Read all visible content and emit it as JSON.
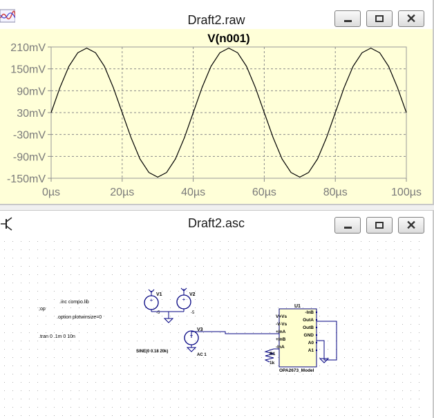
{
  "raw_window": {
    "title": "Draft2.raw",
    "icon": "waveform-icon",
    "controls": {
      "minimize": "minimize-icon",
      "maximize": "maximize-icon",
      "close": "close-icon"
    }
  },
  "asc_window": {
    "title": "Draft2.asc",
    "icon": "transistor-icon",
    "controls": {
      "minimize": "minimize-icon",
      "maximize": "maximize-icon",
      "close": "close-icon"
    }
  },
  "chart_data": {
    "type": "line",
    "title": "V(n001)",
    "xlabel": "",
    "ylabel": "",
    "x_ticks": [
      "0µs",
      "20µs",
      "40µs",
      "60µs",
      "80µs",
      "100µs"
    ],
    "y_ticks": [
      "210mV",
      "150mV",
      "90mV",
      "30mV",
      "-30mV",
      "-90mV",
      "-150mV"
    ],
    "xlim": [
      0,
      100
    ],
    "ylim": [
      -150,
      210
    ],
    "x_unit": "µs",
    "y_unit": "mV",
    "grid": true,
    "series": [
      {
        "color": "#000000",
        "x": [
          0,
          2.5,
          5,
          7.5,
          10,
          12.5,
          15,
          17.5,
          20,
          22.5,
          25,
          27.5,
          30,
          32.5,
          35,
          37.5,
          40,
          42.5,
          45,
          47.5,
          50,
          52.5,
          55,
          57.5,
          60,
          62.5,
          65,
          67.5,
          70,
          72.5,
          75,
          77.5,
          80,
          82.5,
          85,
          87.5,
          90,
          92.5,
          95,
          97.5,
          100
        ],
        "y": [
          30,
          99,
          157,
          194,
          207,
          194,
          157,
          99,
          30,
          -39,
          -97,
          -134,
          -147,
          -134,
          -97,
          -39,
          30,
          99,
          157,
          194,
          207,
          194,
          157,
          99,
          30,
          -39,
          -97,
          -134,
          -147,
          -134,
          -97,
          -39,
          30,
          99,
          157,
          194,
          207,
          194,
          157,
          99,
          30
        ]
      }
    ],
    "plot_background": "#ffffd8",
    "frame_background": "#ffffd8"
  },
  "schematic": {
    "directives": {
      "inc": ".inc compo.lib",
      "op": ";op",
      "option": ".option plotwinsize=0",
      "tran": ".tran 0 .1m 0 10n"
    },
    "sources": {
      "v1": "V1",
      "v2": "V2",
      "v3": "V3",
      "v3_value": "SINE(0 0.18 20k)",
      "v3_ac": "AC 1",
      "v1_minus": "-5",
      "v2_minus": "-5"
    },
    "resistor": {
      "name": "R1",
      "value": "1k"
    },
    "opamp": {
      "ref": "U1",
      "model": "OPA2673_Model",
      "pins_left": [
        "V+Vs",
        "-V-Vs",
        "+InA",
        "+InB",
        "-InA"
      ],
      "pins_right": [
        "-InB",
        "OutA",
        "OutB",
        "GND",
        "A0",
        "A1"
      ]
    },
    "wire_color": "#000080",
    "grid_color": "#b0b0b0"
  }
}
